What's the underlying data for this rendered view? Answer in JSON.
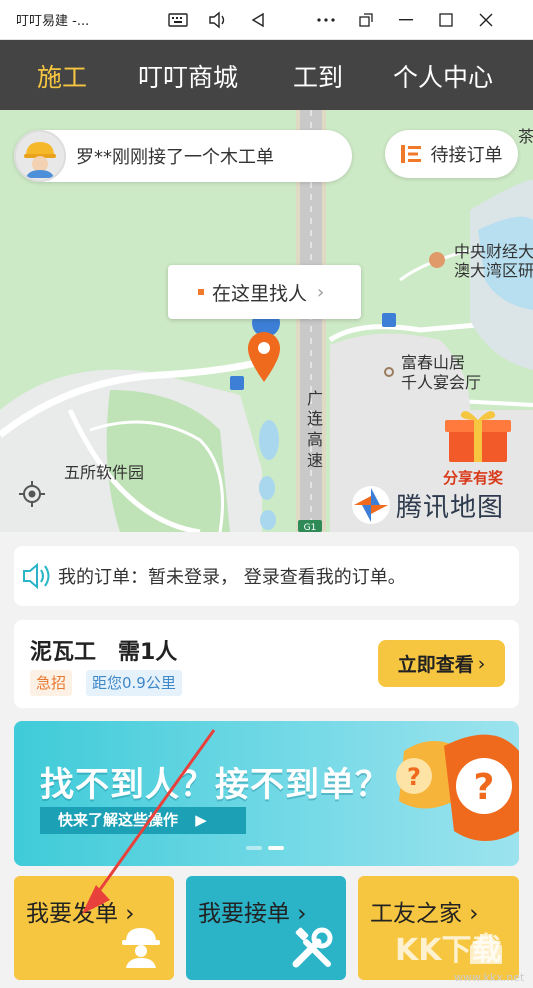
{
  "window": {
    "title": "叮叮易建 -..."
  },
  "nav": {
    "tabs": [
      {
        "label": "施工",
        "active": true
      },
      {
        "label": "叮叮商城",
        "active": false
      },
      {
        "label": "工到",
        "active": false
      },
      {
        "label": "个人中心",
        "active": false
      }
    ]
  },
  "map": {
    "notice": "罗**刚刚接了一个木工单",
    "pending_orders_label": "待接订单",
    "find_here_label": "在这里找人",
    "places": [
      "中央财经大",
      "澳大湾区研",
      "富春山居",
      "千人宴会厅",
      "五所软件园",
      "茶"
    ],
    "road_name": [
      "广",
      "连",
      "高",
      "速"
    ],
    "share_label": "分享有奖",
    "map_provider": "腾讯地图",
    "road_number": "G1"
  },
  "orders": {
    "message": "我的订单：暂未登录， 登录查看我的订单。"
  },
  "job": {
    "title": "泥瓦工　需1人",
    "urgent_badge": "急招",
    "distance_badge": "距您0.9公里",
    "view_button": "立即查看"
  },
  "banner": {
    "headline": "找不到人？接不到单？",
    "subline": "快来了解这些操作"
  },
  "actions": [
    {
      "label": "我要发单",
      "icon": "worker-helmet-icon",
      "color": "#f7c640"
    },
    {
      "label": "我要接单",
      "icon": "tools-icon",
      "color": "#2bb3c8"
    },
    {
      "label": "工友之家",
      "icon": "home-icon",
      "color": "#f7c640"
    }
  ],
  "watermark": {
    "text": "KK下载",
    "url": "www.kkx.net"
  },
  "colors": {
    "accent": "#f7c640",
    "nav_bg": "#444444",
    "teal": "#2bb3c8"
  }
}
